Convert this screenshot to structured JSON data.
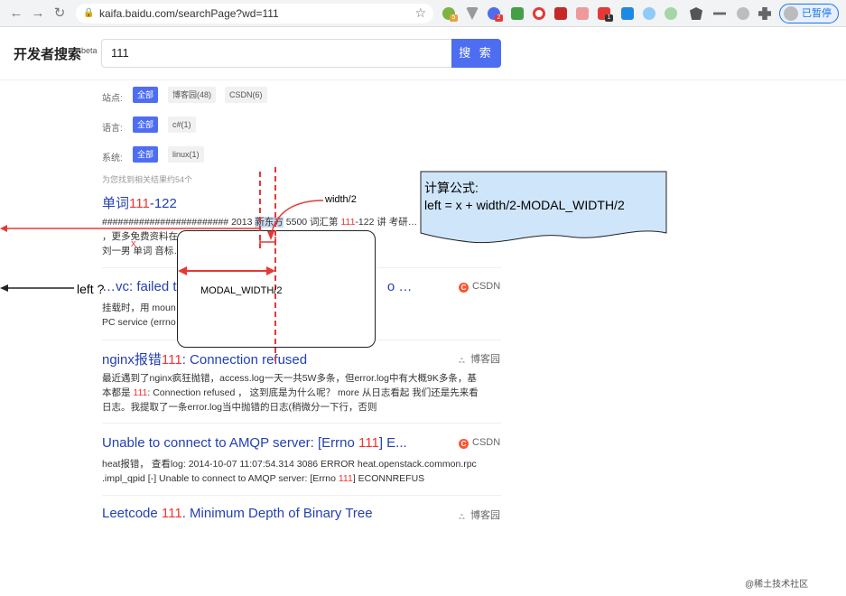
{
  "browser": {
    "url": "kaifa.baidu.com/searchPage?wd=111",
    "paused_label": "已暂停",
    "badges": [
      "5",
      "2",
      "1"
    ]
  },
  "header": {
    "logo": "开发者搜索",
    "logo_sup": "beta",
    "query": "111",
    "search_button": "搜 索"
  },
  "filters": {
    "site_label": "站点:",
    "site_chips": [
      "全部",
      "博客园(48)",
      "CSDN(6)"
    ],
    "lang_label": "语言:",
    "lang_chips": [
      "全部",
      "c#(1)"
    ],
    "sys_label": "系统:",
    "sys_chips": [
      "全部",
      "linux(1)"
    ],
    "count": "为您找到相关结果约54个"
  },
  "results": [
    {
      "title_pre": "单词",
      "title_hl": "111",
      "title_post": "-122",
      "body": "######################## 2013 新东方 5500 词汇第 111-122 讲 考研…\n，更多免费资料在… 0 词汇 111-…\n刘一男 单词 音标…"
    },
    {
      "title_pre": "…vc: failed to…",
      "title_hl": "",
      "title_post": "o …",
      "source": "CSDN",
      "body": "挂载时，用 moun… failed to register lockdv1 R\nPC service (errno… 1"
    },
    {
      "title_pre": "nginx报错",
      "title_hl": "111",
      "title_post": ": Connection refused",
      "source": "博客园",
      "body_1": "最近遇到了nginx疯狂抛错，access.log一天一共5W多条，但error.log中有大概9K多条，基",
      "body_2_pre": "本都是 ",
      "body_2_hl": "111",
      "body_2_post": ": Connection refused ， 这到底是为什么呢？ more 从日志看起 我们还是先来看",
      "body_3": "日志。我提取了一条error.log当中抛错的日志(稍微分一下行，否则"
    },
    {
      "title_pre": "Unable to connect to AMQP server: [Errno ",
      "title_hl": "111",
      "title_post": "] E...",
      "source": "CSDN",
      "body_1": "heat报错， 查看log: 2014-10-07 11:07:54.314 3086 ERROR heat.openstack.common.rpc",
      "body_2_pre": ".impl_qpid [-] Unable to connect to AMQP server: [Errno ",
      "body_2_hl": "111",
      "body_2_post": "] ECONNREFUS"
    },
    {
      "title_pre": "Leetcode ",
      "title_hl": "111",
      "title_post": ". Minimum Depth of Binary Tree",
      "source": "博客园"
    }
  ],
  "annotations": {
    "formula": "计算公式:\nleft = x + width/2-MODAL_WIDTH/2",
    "width_half": "width/2",
    "modal_width": "MODAL_WIDTH/2",
    "x": "x",
    "left_q": "left ?",
    "highlight_word": "新东方"
  },
  "watermark": "@稀土技术社区"
}
